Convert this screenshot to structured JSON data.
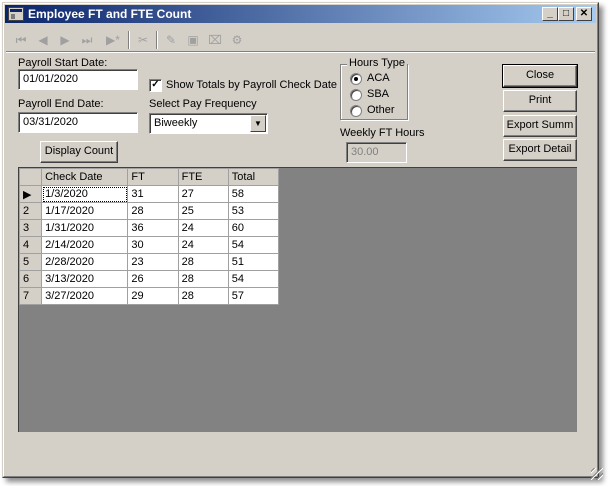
{
  "window": {
    "title": "Employee FT and FTE Count",
    "controls": {
      "minimize": "_",
      "maximize": "□",
      "close": "✕"
    }
  },
  "toolbar": {
    "icons": [
      "first-record-icon",
      "previous-record-icon",
      "next-record-icon",
      "last-record-icon",
      "new-record-icon",
      "delete-icon",
      "edit-icon",
      "save-icon",
      "cancel-icon",
      "properties-icon"
    ]
  },
  "form": {
    "payroll_start_label": "Payroll Start Date:",
    "payroll_start_value": "01/01/2020",
    "payroll_end_label": "Payroll End Date:",
    "payroll_end_value": "03/31/2020",
    "show_totals_label": "Show Totals by Payroll Check Date",
    "show_totals_checked": true,
    "pay_frequency_label": "Select Pay Frequency",
    "pay_frequency_value": "Biweekly",
    "display_count_label": "Display Count",
    "hours_type": {
      "legend": "Hours Type",
      "options": [
        "ACA",
        "SBA",
        "Other"
      ],
      "selected": "ACA"
    },
    "weekly_ft_hours_label": "Weekly FT Hours",
    "weekly_ft_hours_value": "30.00"
  },
  "actions": {
    "close": "Close",
    "print": "Print",
    "export_summ": "Export Summ",
    "export_detail": "Export Detail"
  },
  "grid": {
    "columns": [
      "Check Date",
      "FT",
      "FTE",
      "Total"
    ],
    "rows": [
      {
        "num": "",
        "check_date": "1/3/2020",
        "ft": "31",
        "fte": "27",
        "total": "58"
      },
      {
        "num": "2",
        "check_date": "1/17/2020",
        "ft": "28",
        "fte": "25",
        "total": "53"
      },
      {
        "num": "3",
        "check_date": "1/31/2020",
        "ft": "36",
        "fte": "24",
        "total": "60"
      },
      {
        "num": "4",
        "check_date": "2/14/2020",
        "ft": "30",
        "fte": "24",
        "total": "54"
      },
      {
        "num": "5",
        "check_date": "2/28/2020",
        "ft": "23",
        "fte": "28",
        "total": "51"
      },
      {
        "num": "6",
        "check_date": "3/13/2020",
        "ft": "26",
        "fte": "28",
        "total": "54"
      },
      {
        "num": "7",
        "check_date": "3/27/2020",
        "ft": "29",
        "fte": "28",
        "total": "57"
      }
    ]
  }
}
